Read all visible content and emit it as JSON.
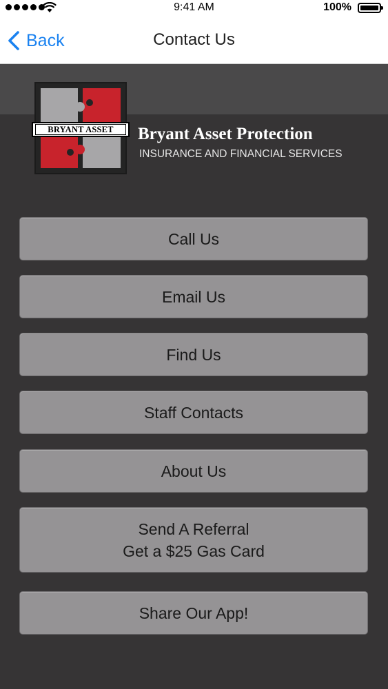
{
  "status_bar": {
    "time": "9:41 AM",
    "battery": "100%",
    "signal_icon": "signal-dots-icon",
    "wifi_icon": "wifi-icon",
    "battery_icon": "battery-icon"
  },
  "nav": {
    "back_label": "Back",
    "back_icon": "chevron-left-icon",
    "title": "Contact Us",
    "accent_color": "#1a82f0"
  },
  "header": {
    "logo_text": "BRYANT ASSET",
    "company_name": "Bryant Asset Protection",
    "tagline": "INSURANCE AND FINANCIAL SERVICES",
    "brand_red": "#c8232c",
    "brand_gray": "#a7a6a8"
  },
  "menu": {
    "call": "Call Us",
    "email": "Email Us",
    "find": "Find Us",
    "staff": "Staff Contacts",
    "about": "About Us",
    "referral_line1": "Send A Referral",
    "referral_line2": "Get a $25 Gas Card",
    "share": "Share Our App!"
  }
}
